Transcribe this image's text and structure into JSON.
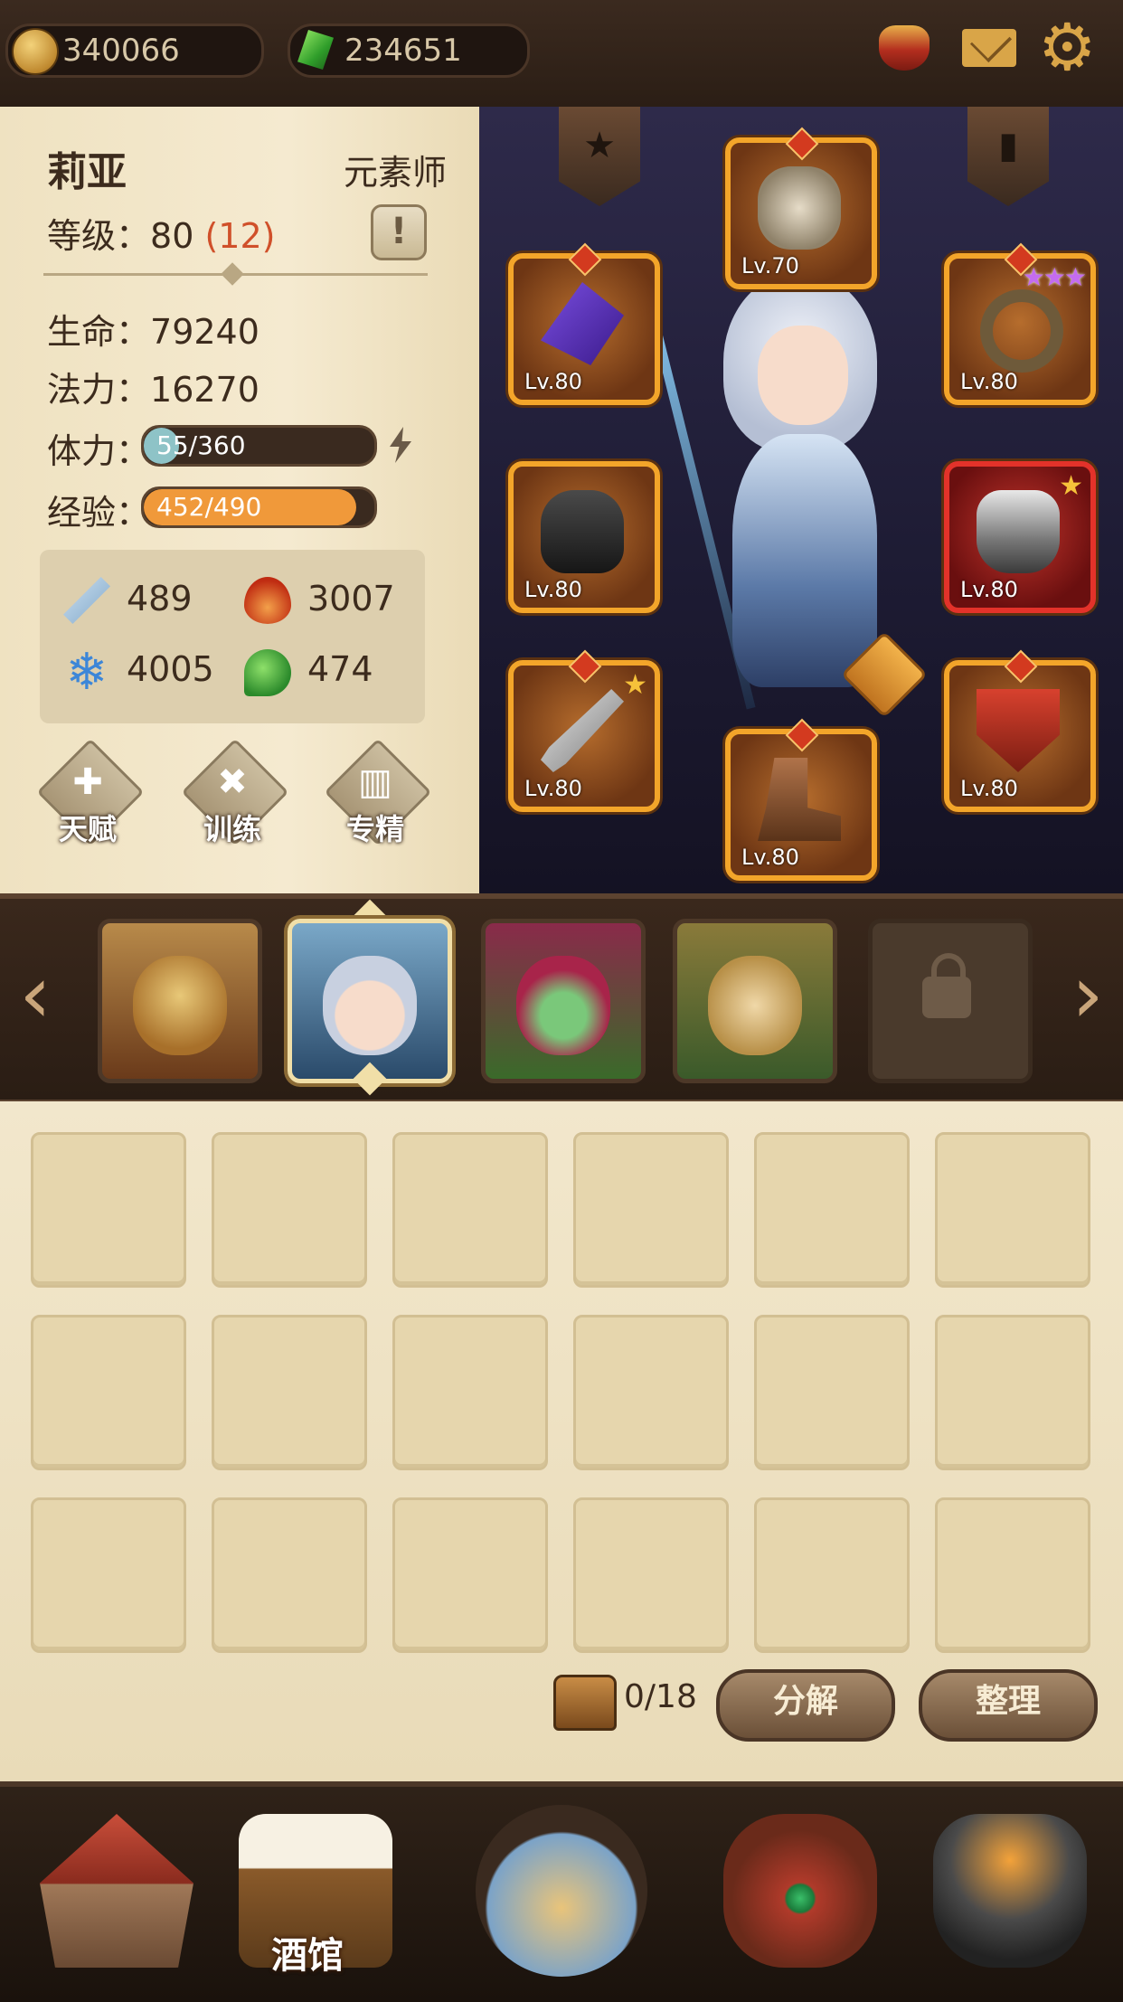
{
  "currency": {
    "gold": "340066",
    "gems": "234651"
  },
  "top_icons": [
    "horn-icon",
    "mail-icon",
    "gear-icon"
  ],
  "hero": {
    "name": "莉亚",
    "class": "元素师",
    "level_label": "等级：",
    "level": "80",
    "level_bonus": "(12)",
    "info_label": "!",
    "hp_label": "生命：",
    "hp": "79240",
    "mp_label": "法力：",
    "mp": "16270",
    "stamina_label": "体力：",
    "stamina": "55/360",
    "stamina_fraction": 0.153,
    "exp_label": "经验：",
    "exp": "452/490",
    "exp_fraction": 0.922,
    "attributes": {
      "attack": "489",
      "fire": "3007",
      "frost": "4005",
      "nature": "474"
    }
  },
  "skills": [
    {
      "label": "天赋",
      "symbol": "✚"
    },
    {
      "label": "训练",
      "symbol": "✖"
    },
    {
      "label": "专精",
      "symbol": "▥"
    }
  ],
  "equipment": {
    "banners": [
      "★",
      "▮"
    ],
    "slots": [
      {
        "level": "Lv.70",
        "item": "mask"
      },
      {
        "level": "Lv.80",
        "item": "amulet"
      },
      {
        "level": "Lv.80",
        "item": "ring",
        "stars": "★★★"
      },
      {
        "level": "Lv.80",
        "item": "glove"
      },
      {
        "level": "Lv.80",
        "item": "armor",
        "star": "★"
      },
      {
        "level": "Lv.80",
        "item": "dagger",
        "star": "★"
      },
      {
        "level": "Lv.80",
        "item": "boot"
      },
      {
        "level": "Lv.80",
        "item": "shield"
      }
    ]
  },
  "hero_selector": {
    "prev": "‹",
    "next": "›"
  },
  "inventory": {
    "count": "0/18",
    "decompose_label": "分解",
    "sort_label": "整理"
  },
  "bottom_nav": {
    "tavern_label": "酒馆"
  },
  "colors": {
    "stamina_fill": "#8ec3c7",
    "exp_fill": "#f0993a",
    "slot_border": "#f3a52a",
    "accent_red": "#d0502a"
  }
}
